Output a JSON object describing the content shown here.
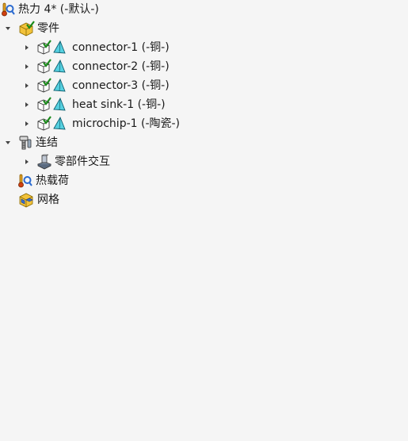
{
  "study": {
    "label": "热力 4* (-默认-)",
    "icon": "thermal-study-icon"
  },
  "parts": {
    "label": "零件",
    "icon": "parts-folder-icon",
    "items": [
      {
        "label": "connector-1 (-铜-)",
        "icon": "solid-body-icon"
      },
      {
        "label": "connector-2 (-铜-)",
        "icon": "solid-body-icon"
      },
      {
        "label": "connector-3 (-铜-)",
        "icon": "solid-body-icon"
      },
      {
        "label": "heat sink-1 (-铜-)",
        "icon": "solid-body-icon"
      },
      {
        "label": "microchip-1 (-陶瓷-)",
        "icon": "solid-body-icon"
      }
    ]
  },
  "connections": {
    "label": "连结",
    "icon": "connections-icon",
    "items": [
      {
        "label": "零部件交互",
        "icon": "component-interaction-icon"
      }
    ]
  },
  "thermal_loads": {
    "label": "热载荷",
    "icon": "thermal-loads-icon"
  },
  "mesh": {
    "label": "网格",
    "icon": "mesh-icon"
  }
}
